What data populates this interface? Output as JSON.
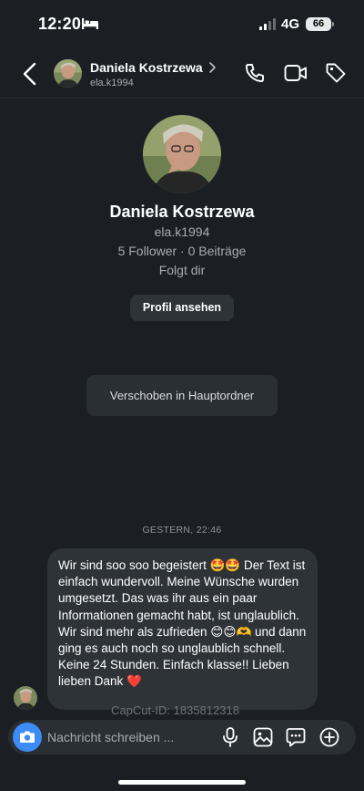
{
  "status_bar": {
    "time": "12:20",
    "network": "4G",
    "battery": "66"
  },
  "header": {
    "name": "Daniela Kostrzewa",
    "username": "ela.k1994"
  },
  "profile": {
    "name": "Daniela Kostrzewa",
    "username": "ela.k1994",
    "stats": "5 Follower · 0 Beiträge",
    "follow_status": "Folgt dir",
    "view_profile_label": "Profil ansehen"
  },
  "moved_notice": "Verschoben in Hauptordner",
  "conversation": {
    "timestamp": "GESTERN, 22:46",
    "message": "Wir sind soo soo begeistert 🤩🤩 Der Text ist einfach wundervoll. Meine Wünsche wurden umgesetzt. Das was ihr aus ein paar Informationen gemacht habt, ist unglaublich. Wir sind mehr als zufrieden 😊😊🫶 und dann ging es auch noch so unglaublich schnell. Keine 24 Stunden. Einfach klasse!! Lieben lieben Dank ❤️"
  },
  "watermark": "CapCut-ID: 1835812318",
  "composer": {
    "placeholder": "Nachricht schreiben ..."
  },
  "colors": {
    "background": "#1b1f23",
    "bubble": "#2e3338",
    "accent": "#3d8bf5"
  },
  "icons": [
    "bed-icon",
    "signal-icon",
    "back-icon",
    "chevron-right-icon",
    "phone-icon",
    "video-icon",
    "tag-icon",
    "camera-icon",
    "mic-icon",
    "gallery-icon",
    "sticker-icon",
    "add-icon"
  ]
}
